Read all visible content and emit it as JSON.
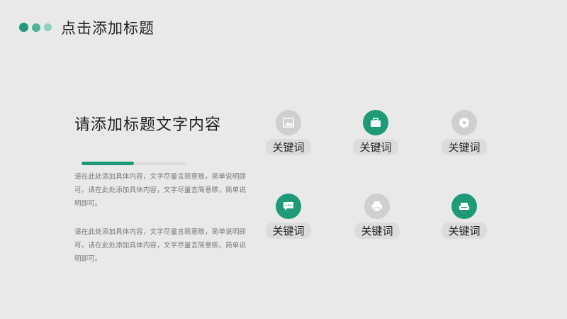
{
  "header": {
    "title": "点击添加标题"
  },
  "content": {
    "title": "请添加标题文字内容",
    "progress": 0.5,
    "paragraph1": "请在此处添加具体内容，文字尽量言简意赅，简单说明即可。请在此处添加具体内容，文字尽量言简意赅，简单说明即可。",
    "paragraph2": "请在此处添加具体内容，文字尽量言简意赅，简单说明即可。请在此处添加具体内容，文字尽量言简意赅，简单说明即可。"
  },
  "keywords": [
    {
      "label": "关键词",
      "icon": "image-icon",
      "active": false
    },
    {
      "label": "关键词",
      "icon": "briefcase-icon",
      "active": true
    },
    {
      "label": "关键词",
      "icon": "disc-icon",
      "active": false
    },
    {
      "label": "关键词",
      "icon": "chat-icon",
      "active": true
    },
    {
      "label": "关键词",
      "icon": "printer-icon",
      "active": false
    },
    {
      "label": "关键词",
      "icon": "sofa-icon",
      "active": true
    }
  ],
  "colors": {
    "accent": "#1e9a78",
    "inactive": "#cfcfcf",
    "background": "#e9e9e9"
  }
}
